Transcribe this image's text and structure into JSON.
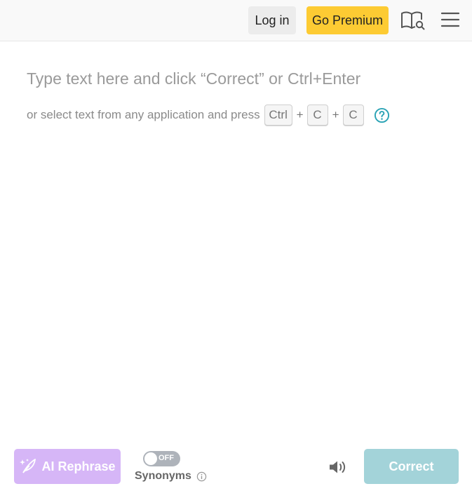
{
  "header": {
    "login_label": "Log in",
    "premium_label": "Go Premium",
    "icons": [
      "dictionary-icon",
      "menu-icon"
    ],
    "colors": {
      "premium": "#fdcb33",
      "login_bg": "#ececec"
    }
  },
  "editor": {
    "placeholder": "Type text here and click “Correct” or Ctrl+Enter",
    "hint_prefix": "or select text from any application and press",
    "keys": [
      "Ctrl",
      "C",
      "C"
    ],
    "plus": "+",
    "help_icon": "help-circle-icon",
    "help_color": "#2aa3b5"
  },
  "footer": {
    "rephrase_label": "AI Rephrase",
    "rephrase_color": "#d6b6f7",
    "synonyms_toggle_state": "OFF",
    "synonyms_label": "Synonyms",
    "correct_label": "Correct",
    "correct_color": "#a3d3d9"
  }
}
